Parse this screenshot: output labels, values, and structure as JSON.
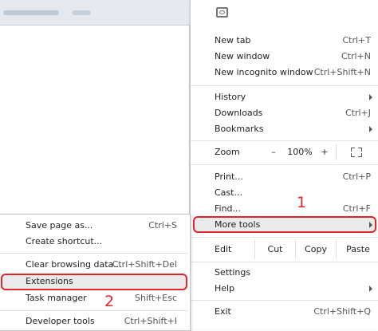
{
  "menu": {
    "items_top": [
      {
        "label": "New tab",
        "shortcut": "Ctrl+T"
      },
      {
        "label": "New window",
        "shortcut": "Ctrl+N"
      },
      {
        "label": "New incognito window",
        "shortcut": "Ctrl+Shift+N"
      }
    ],
    "history": {
      "label": "History"
    },
    "downloads": {
      "label": "Downloads",
      "shortcut": "Ctrl+J"
    },
    "bookmarks": {
      "label": "Bookmarks"
    },
    "zoom": {
      "label": "Zoom",
      "minus": "–",
      "value": "100%",
      "plus": "+"
    },
    "print": {
      "label": "Print...",
      "shortcut": "Ctrl+P"
    },
    "cast": {
      "label": "Cast..."
    },
    "find": {
      "label": "Find...",
      "shortcut": "Ctrl+F"
    },
    "more_tools": {
      "label": "More tools"
    },
    "edit": {
      "label": "Edit",
      "cut": "Cut",
      "copy": "Copy",
      "paste": "Paste"
    },
    "settings": {
      "label": "Settings"
    },
    "help": {
      "label": "Help"
    },
    "exit": {
      "label": "Exit",
      "shortcut": "Ctrl+Shift+Q"
    }
  },
  "submenu": {
    "items": [
      {
        "label": "Save page as...",
        "shortcut": "Ctrl+S"
      },
      {
        "label": "Create shortcut..."
      },
      {
        "label": "Clear browsing data...",
        "shortcut": "Ctrl+Shift+Del"
      },
      {
        "label": "Extensions"
      },
      {
        "label": "Task manager",
        "shortcut": "Shift+Esc"
      },
      {
        "label": "Developer tools",
        "shortcut": "Ctrl+Shift+I"
      }
    ]
  },
  "annotations": {
    "step1": "1",
    "step2": "2"
  },
  "colors": {
    "highlight_border": "#e0262b",
    "highlight_fill": "#eaeaea"
  }
}
